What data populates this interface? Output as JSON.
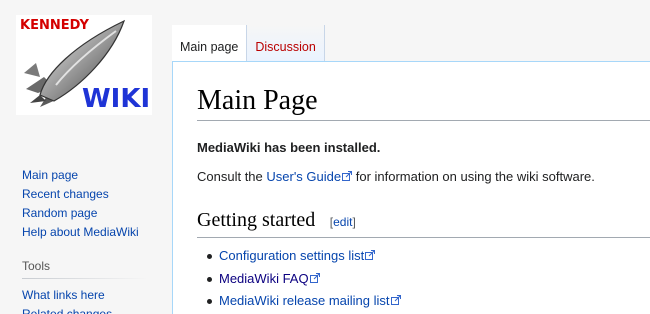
{
  "logo": {
    "top_text": "KENNEDY",
    "bottom_text": "WIKI",
    "image": "rocket-logo"
  },
  "sidebar": {
    "navigation": [
      {
        "label": "Main page"
      },
      {
        "label": "Recent changes"
      },
      {
        "label": "Random page"
      },
      {
        "label": "Help about MediaWiki"
      }
    ],
    "tools": {
      "heading": "Tools",
      "items": [
        {
          "label": "What links here"
        },
        {
          "label": "Related changes"
        }
      ]
    }
  },
  "tabs": [
    {
      "label": "Main page",
      "selected": true
    },
    {
      "label": "Discussion",
      "selected": false
    }
  ],
  "content": {
    "title": "Main Page",
    "installed": "MediaWiki has been installed.",
    "consult_prefix": "Consult the ",
    "consult_link": "User's Guide",
    "consult_suffix": " for information on using the wiki software.",
    "section_title": "Getting started",
    "edit_open": "[",
    "edit_label": "edit",
    "edit_close": "]",
    "links": [
      {
        "label": "Configuration settings list"
      },
      {
        "label": "MediaWiki FAQ"
      },
      {
        "label": "MediaWiki release mailing list"
      }
    ]
  },
  "colors": {
    "link": "#0645ad",
    "visited": "#0b0080",
    "new_link": "#ba0000",
    "border": "#a7d7f9"
  }
}
